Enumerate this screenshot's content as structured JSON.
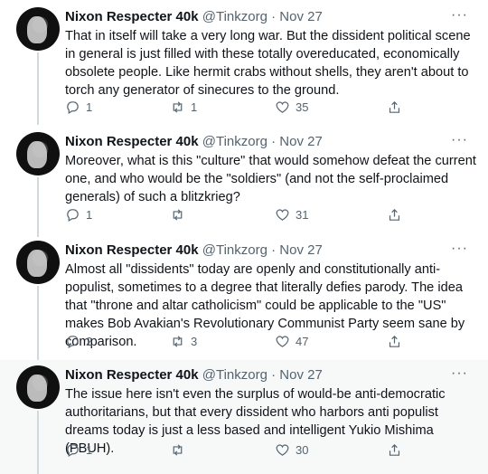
{
  "tweets": [
    {
      "name": "Nixon Respecter 40k",
      "handle": "@Tinkzorg",
      "sep": "·",
      "date": "Nov 27",
      "more": "···",
      "text": "That in itself will take a very long war. But the dissident political scene in general is just filled with these totally overeducated, economically obsolete people. Like hermit crabs without shells, they aren't about to torch any generator of sinecures to the ground.",
      "replies": "1",
      "retweets": "1",
      "likes": "35"
    },
    {
      "name": "Nixon Respecter 40k",
      "handle": "@Tinkzorg",
      "sep": "·",
      "date": "Nov 27",
      "more": "···",
      "text": "Moreover, what is this \"culture\" that would somehow defeat the current one, and who would be the \"soldiers\" (and not the self-proclaimed generals) of such a blitzkrieg?",
      "replies": "1",
      "retweets": "",
      "likes": "31"
    },
    {
      "name": "Nixon Respecter 40k",
      "handle": "@Tinkzorg",
      "sep": "·",
      "date": "Nov 27",
      "more": "···",
      "text": "Almost all \"dissidents\" today are openly and constitutionally anti-populist, sometimes to a degree that literally defies parody. The idea that \"throne and altar catholicism\" could be applicable to the \"US\" makes Bob Avakian's Revolutionary Communist Party seem sane by comparison.",
      "replies": "2",
      "retweets": "3",
      "likes": "47"
    },
    {
      "name": "Nixon Respecter 40k",
      "handle": "@Tinkzorg",
      "sep": "·",
      "date": "Nov 27",
      "more": "···",
      "text": "The issue here isn't even the surplus of would-be anti-democratic authoritarians, but that every dissident who harbors anti populist dreams today is just a less based and intelligent Yukio Mishima (PBUH).",
      "replies": "1",
      "retweets": "",
      "likes": "30"
    }
  ],
  "icons": {
    "reply": "reply-icon",
    "retweet": "retweet-icon",
    "like": "heart-icon",
    "share": "share-icon",
    "more": "more-icon"
  },
  "colors": {
    "text": "#0f1419",
    "muted": "#536471",
    "thread_line": "#cfd9de",
    "highlight_bg": "#f7f9f9"
  }
}
